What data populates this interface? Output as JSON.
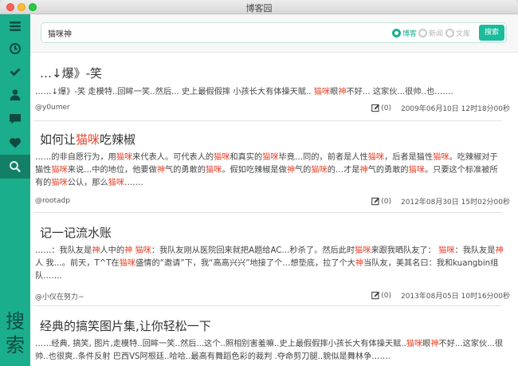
{
  "window": {
    "title": "博客园"
  },
  "sidebar": {
    "items": [
      {
        "name": "menu",
        "icon": "menu-icon"
      },
      {
        "name": "clock",
        "icon": "clock-icon"
      },
      {
        "name": "check",
        "icon": "check-icon"
      },
      {
        "name": "user",
        "icon": "user-icon"
      },
      {
        "name": "comment",
        "icon": "comment-icon"
      },
      {
        "name": "heart",
        "icon": "heart-icon"
      },
      {
        "name": "search",
        "icon": "search-icon",
        "active": true
      }
    ],
    "vertical_label": [
      "搜",
      "索"
    ]
  },
  "search": {
    "query": "猫咪神",
    "options": [
      {
        "label": "博客",
        "selected": true
      },
      {
        "label": "新闻",
        "selected": false
      },
      {
        "label": "文库",
        "selected": false
      }
    ],
    "button_label": "搜索"
  },
  "highlight_color": "#e8432b",
  "accent_color": "#1aae8d",
  "posts": [
    {
      "title": [
        {
          "t": "…↓爆》-笑"
        }
      ],
      "body": [
        {
          "t": "……↓爆》-笑 走模特..回眸一笑..然后... 史上最假假摔 小孩长大有体操天赋.. "
        },
        {
          "t": "猫咪",
          "hl": true
        },
        {
          "t": "眼"
        },
        {
          "t": "神",
          "hl": true
        },
        {
          "t": "不好... 这家伙...很帅..也……."
        }
      ],
      "author": "@y0umer",
      "comments": "(0)",
      "date": "2009年06月10日 12时18分00秒"
    },
    {
      "title": [
        {
          "t": "如何让"
        },
        {
          "t": "猫咪",
          "hl": true
        },
        {
          "t": "吃辣椒"
        }
      ],
      "body": [
        {
          "t": "……的非自愿行为，用"
        },
        {
          "t": "猫咪",
          "hl": true
        },
        {
          "t": "来代表人。可代表人的"
        },
        {
          "t": "猫咪",
          "hl": true
        },
        {
          "t": "和真实的"
        },
        {
          "t": "猫咪",
          "hl": true
        },
        {
          "t": "毕竟…同的，前者是人性"
        },
        {
          "t": "猫咪",
          "hl": true
        },
        {
          "t": "，后者是猫性"
        },
        {
          "t": "猫咪",
          "hl": true
        },
        {
          "t": "。吃辣椒对于猫性"
        },
        {
          "t": "猫咪",
          "hl": true
        },
        {
          "t": "来说…中的地位，他要做"
        },
        {
          "t": "神",
          "hl": true
        },
        {
          "t": "气的勇敢的"
        },
        {
          "t": "猫咪",
          "hl": true
        },
        {
          "t": "。假如吃辣椒是做"
        },
        {
          "t": "神",
          "hl": true
        },
        {
          "t": "气的"
        },
        {
          "t": "猫咪",
          "hl": true
        },
        {
          "t": "的…才是"
        },
        {
          "t": "神",
          "hl": true
        },
        {
          "t": "气的勇敢的"
        },
        {
          "t": "猫咪",
          "hl": true
        },
        {
          "t": "。只要这个标准被所有的"
        },
        {
          "t": "猫咪",
          "hl": true
        },
        {
          "t": "公认，那么"
        },
        {
          "t": "猫咪",
          "hl": true
        },
        {
          "t": "……."
        }
      ],
      "author": "@rootadp",
      "comments": "(0)",
      "date": "2012年08月30日 15时02分00秒"
    },
    {
      "title": [
        {
          "t": "记一记流水账"
        }
      ],
      "body": [
        {
          "t": "……：我队友是"
        },
        {
          "t": "神",
          "hl": true
        },
        {
          "t": "人中的"
        },
        {
          "t": "神",
          "hl": true
        },
        {
          "t": " "
        },
        {
          "t": "猫咪",
          "hl": true
        },
        {
          "t": "：我队友刚从医院回来就把A题给AC…秒杀了。然后此时"
        },
        {
          "t": "猫咪",
          "hl": true
        },
        {
          "t": "来跟我晒队友了：  "
        },
        {
          "t": "猫咪",
          "hl": true
        },
        {
          "t": "：我队友是"
        },
        {
          "t": "神",
          "hl": true
        },
        {
          "t": "人 我…。前天，T^T在"
        },
        {
          "t": "猫咪",
          "hl": true
        },
        {
          "t": "盛情的“邀请”下，我“高高兴兴”地接了个…想垫底，拉了个大"
        },
        {
          "t": "神",
          "hl": true
        },
        {
          "t": "当队友，美其名曰：我和kuangbin组队……."
        }
      ],
      "author": "@小仪在努力~",
      "comments": "(0)",
      "date": "2013年08月05日 10时16分00秒"
    },
    {
      "title": [
        {
          "t": "经典的搞笑图片集,让你轻松一下"
        }
      ],
      "body": [
        {
          "t": "……经典, 搞笑, 图片,走模特..回眸一笑..然后...这个..照相别害羞嘛..史上最假假摔小孩长大有体操天赋.."
        },
        {
          "t": "猫咪",
          "hl": true
        },
        {
          "t": "眼"
        },
        {
          "t": "神",
          "hl": true
        },
        {
          "t": "不好...这家伙...很帅..也很爽..条件反射 巴西VS阿根廷..哈哈..最高有舞蹈色彩的裁判 .夺命剪刀腿..貌似是舞林争……."
        }
      ],
      "author": "",
      "comments": "",
      "date": ""
    }
  ]
}
